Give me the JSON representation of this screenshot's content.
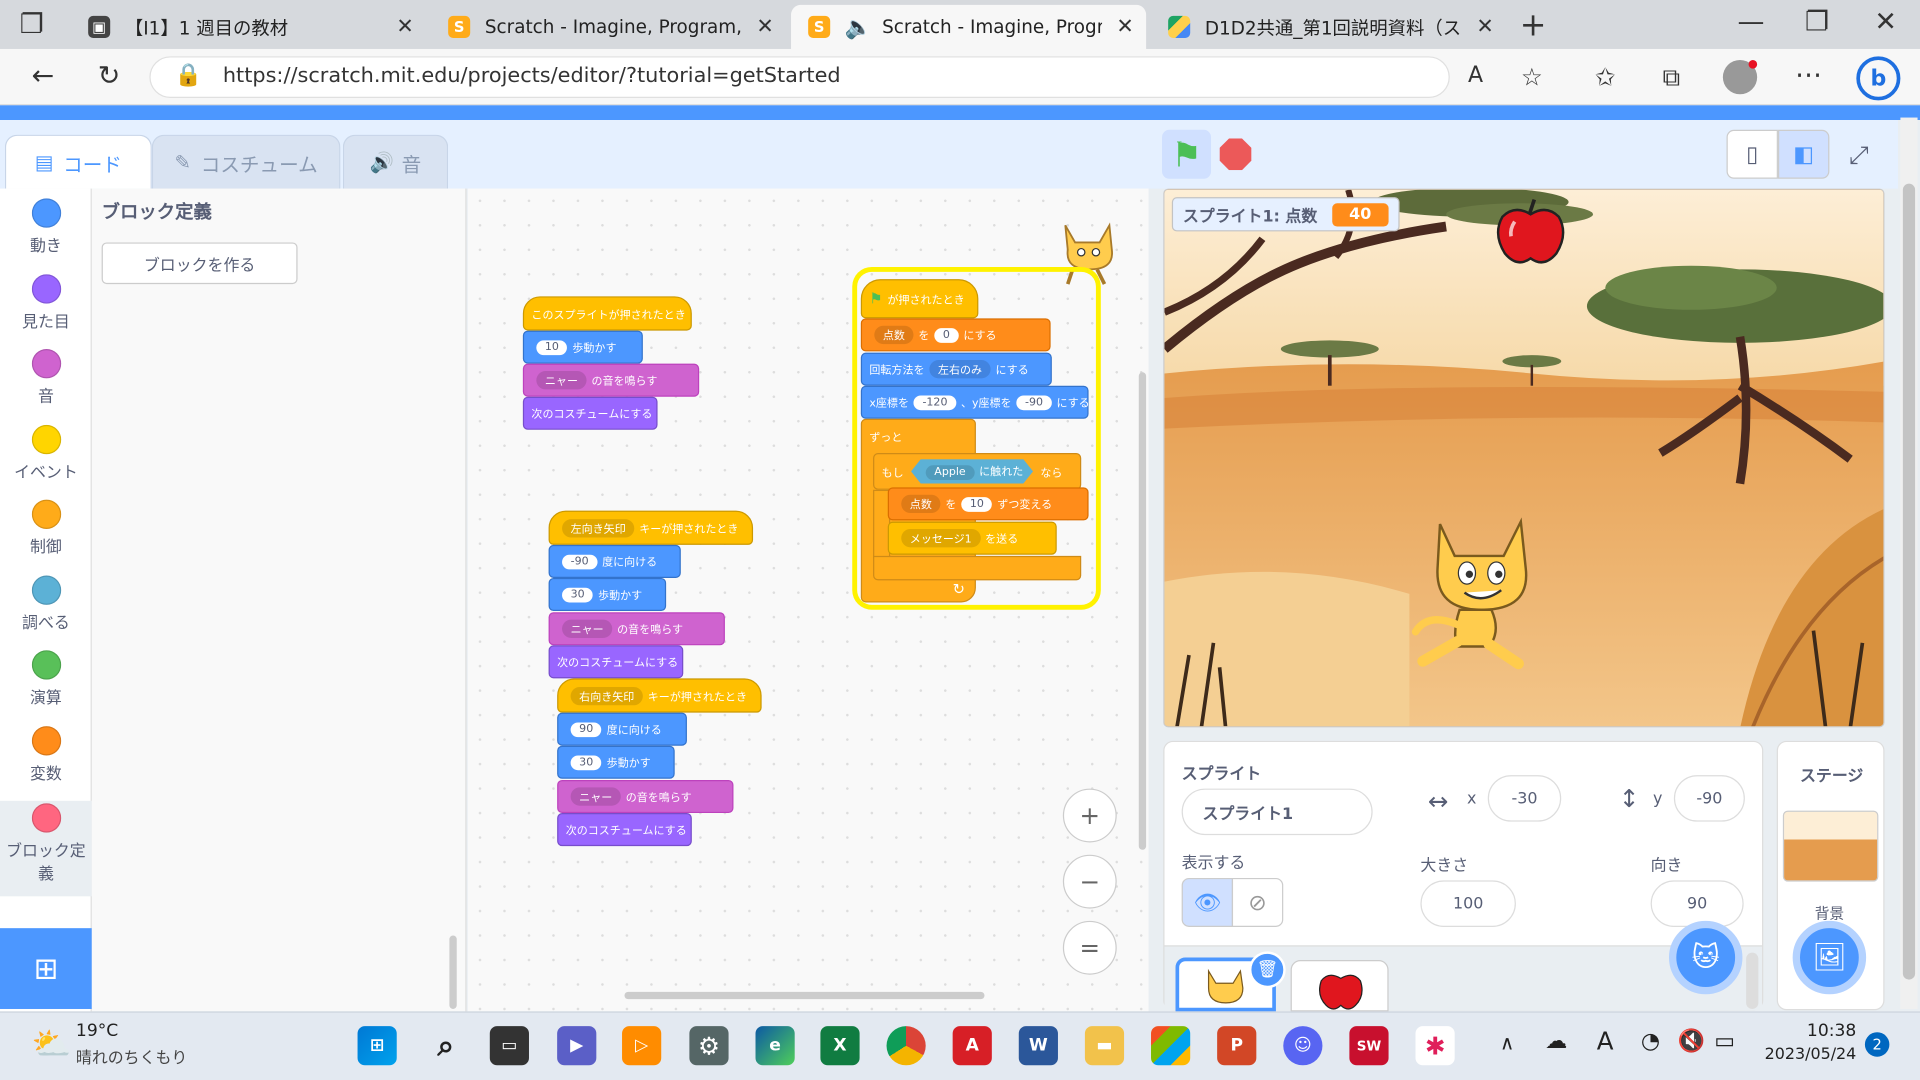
{
  "browser": {
    "tabs": [
      {
        "title": "【I1】1 週目の教材",
        "active": false
      },
      {
        "title": "Scratch - Imagine, Program, Share",
        "active": false
      },
      {
        "title": "Scratch - Imagine, Program, Share",
        "active": true
      },
      {
        "title": "D1D2共通_第1回説明資料（スケジュール）",
        "active": false
      }
    ],
    "url": "https://scratch.mit.edu/projects/editor/?tutorial=getStarted",
    "new_tab": "+",
    "close": "✕"
  },
  "editor": {
    "tabs": {
      "code": "コード",
      "costumes": "コスチューム",
      "sounds": "音"
    },
    "categories": [
      {
        "label": "動き",
        "color": "#4c97ff"
      },
      {
        "label": "見た目",
        "color": "#9966ff"
      },
      {
        "label": "音",
        "color": "#cf63cf"
      },
      {
        "label": "イベント",
        "color": "#ffd500"
      },
      {
        "label": "制御",
        "color": "#ffab19"
      },
      {
        "label": "調べる",
        "color": "#5cb1d6"
      },
      {
        "label": "演算",
        "color": "#59c059"
      },
      {
        "label": "変数",
        "color": "#ff8c1a"
      },
      {
        "label": "ブロック定義",
        "color": "#ff6680"
      }
    ],
    "flyout": {
      "heading": "ブロック定義",
      "make_block": "ブロックを作る"
    },
    "zoom": {
      "in": "+",
      "out": "−",
      "reset": "="
    }
  },
  "scripts": {
    "s1": {
      "hat": "このスプライトが押されたとき",
      "move_val": "10",
      "move_label": "歩動かす",
      "sound_dd": "ニャー",
      "sound_label": "の音を鳴らす",
      "costume": "次のコスチュームにする"
    },
    "s2": {
      "key_dd": "左向き矢印",
      "hat_label": "キーが押されたとき",
      "dir_val": "-90",
      "dir_label": "度に向ける",
      "move_val": "30",
      "move_label": "歩動かす",
      "sound_dd": "ニャー",
      "sound_label": "の音を鳴らす",
      "costume": "次のコスチュームにする"
    },
    "s3": {
      "key_dd": "右向き矢印",
      "hat_label": "キーが押されたとき",
      "dir_val": "90",
      "dir_label": "度に向ける",
      "move_val": "30",
      "move_label": "歩動かす",
      "sound_dd": "ニャー",
      "sound_label": "の音を鳴らす",
      "costume": "次のコスチュームにする"
    },
    "s4": {
      "hat_label": "が押されたとき",
      "set_var_dd": "点数",
      "set_to": "を",
      "set_val": "0",
      "set_end": "にする",
      "rot_label": "回転方法を",
      "rot_dd": "左右のみ",
      "rot_end": "にする",
      "xy_x_label": "x座標を",
      "xy_x": "-120",
      "xy_y_label": "、y座標を",
      "xy_y": "-90",
      "xy_end": "にする",
      "forever": "ずっと",
      "if_label": "もし",
      "touch_dd": "Apple",
      "touch_label": "に触れた",
      "if_then": "なら",
      "change_dd": "点数",
      "change_to": "を",
      "change_val": "10",
      "change_end": "ずつ変える",
      "bcast_dd": "メッセージ1",
      "bcast_label": "を送る",
      "arrow": "↻"
    }
  },
  "stage": {
    "monitor_label": "スプライト1: 点数",
    "monitor_value": "40"
  },
  "sprite_info": {
    "title": "スプライト",
    "name": "スプライト1",
    "x_label": "x",
    "x": "-30",
    "y_label": "y",
    "y": "-90",
    "show_label": "表示する",
    "size_label": "大きさ",
    "size": "100",
    "dir_label": "向き",
    "dir": "90"
  },
  "stage_pane": {
    "title": "ステージ",
    "backdrop_label": "背景"
  },
  "taskbar": {
    "weather_temp": "19°C",
    "weather_desc": "晴れのちくもり",
    "time": "10:38",
    "date": "2023/05/24",
    "notif_count": "2"
  }
}
